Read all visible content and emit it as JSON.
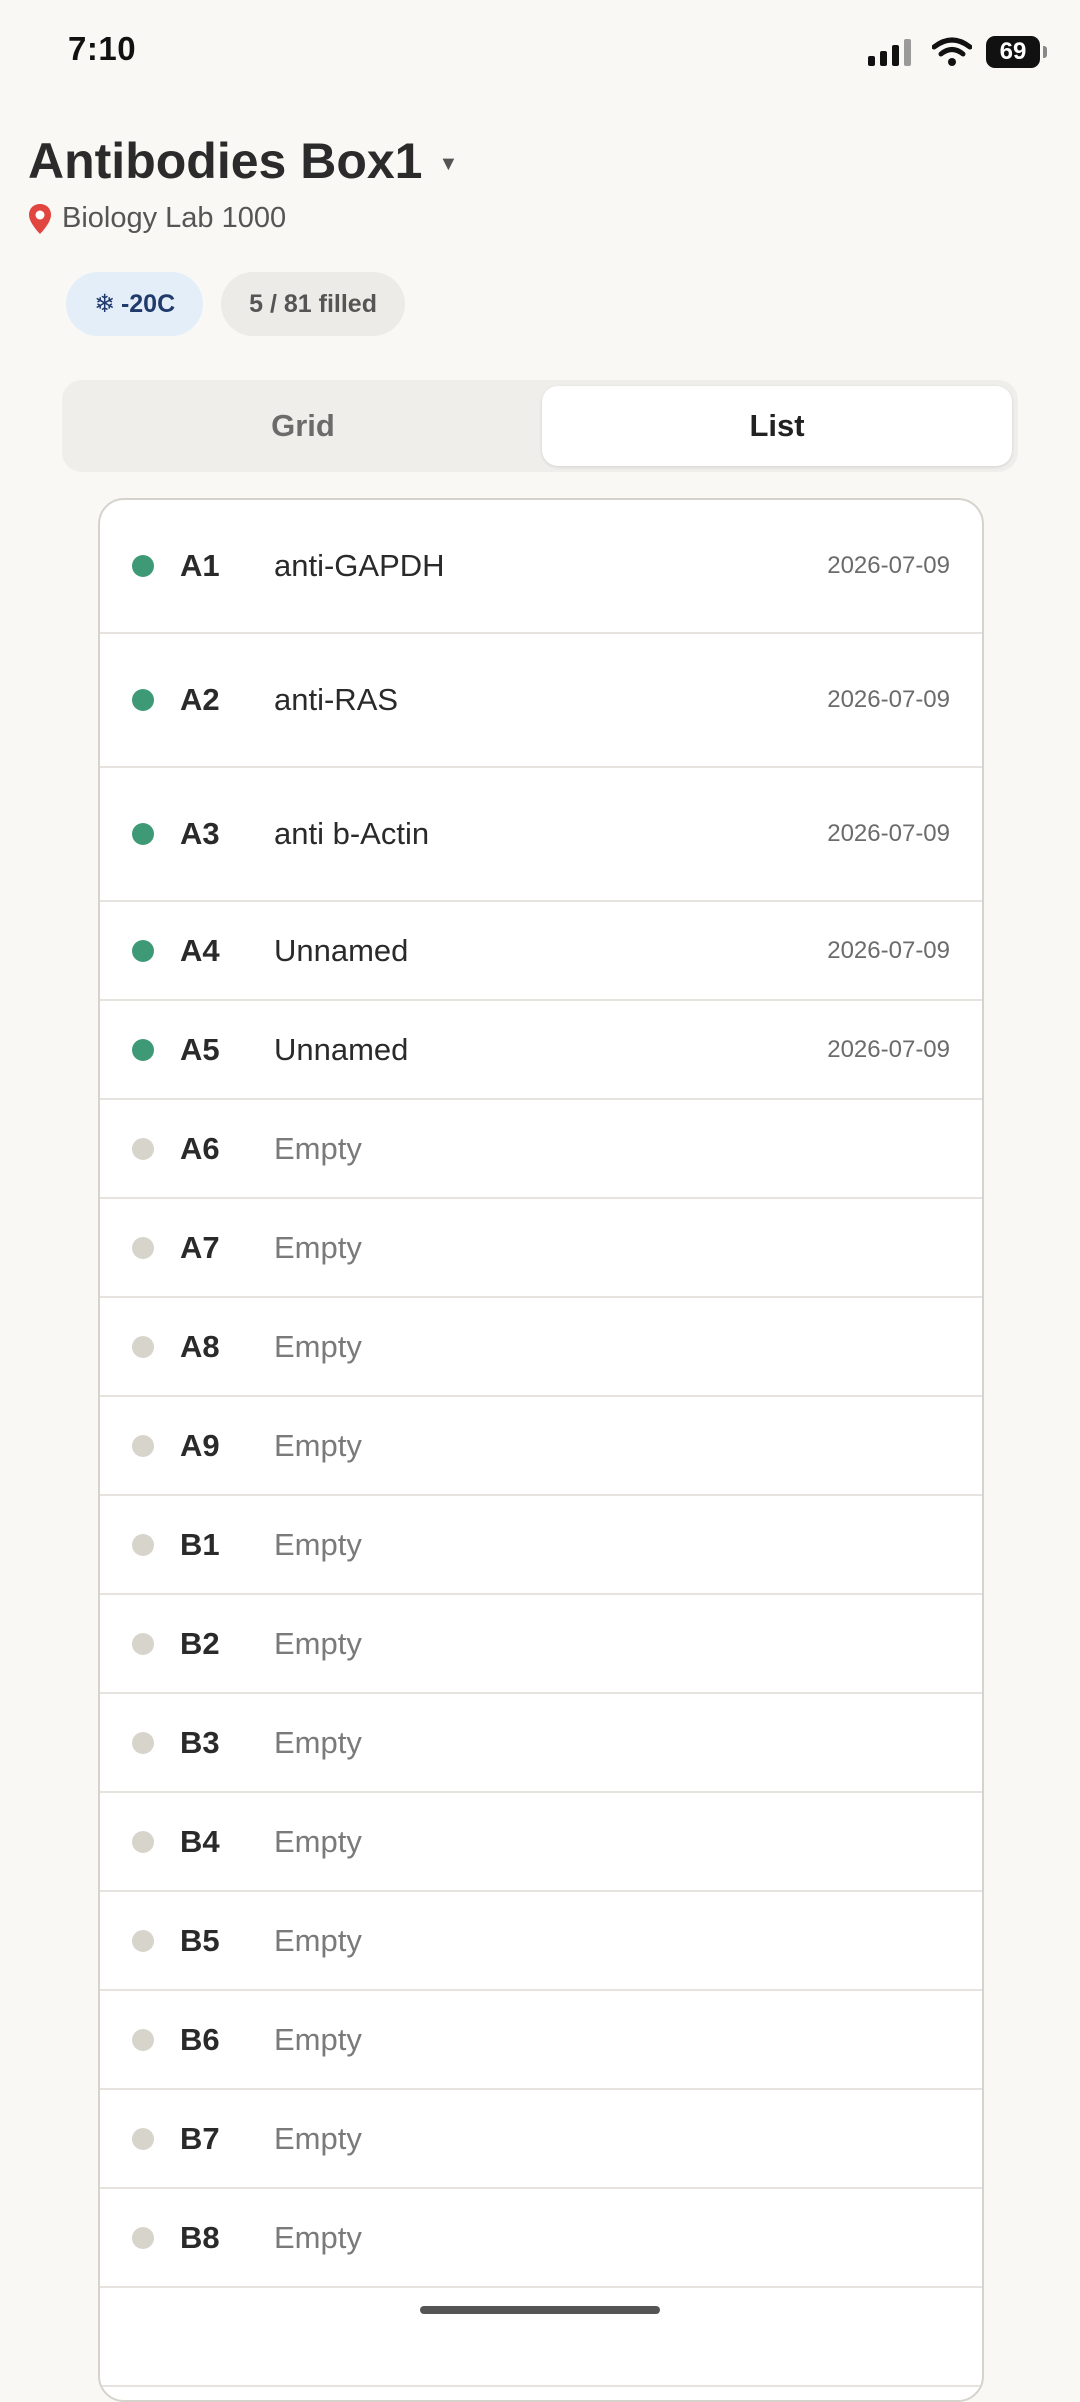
{
  "status_bar": {
    "time": "7:10",
    "battery": "69"
  },
  "header": {
    "title": "Antibodies Box1",
    "location": "Biology Lab 1000"
  },
  "chips": {
    "temperature": "-20C",
    "filled": "5 / 81 filled"
  },
  "view_toggle": {
    "grid_label": "Grid",
    "list_label": "List",
    "selected": "List"
  },
  "colors": {
    "filled_dot": "#3e9a76",
    "empty_dot": "#d7d4cc",
    "accent_blue": "#1f3a6b"
  },
  "list": {
    "rows": [
      {
        "position": "A1",
        "name": "anti-GAPDH",
        "date": "2026-07-09",
        "filled": true
      },
      {
        "position": "A2",
        "name": "anti-RAS",
        "date": "2026-07-09",
        "filled": true
      },
      {
        "position": "A3",
        "name": "anti b-Actin",
        "date": "2026-07-09",
        "filled": true
      },
      {
        "position": "A4",
        "name": "Unnamed",
        "date": "2026-07-09",
        "filled": true
      },
      {
        "position": "A5",
        "name": "Unnamed",
        "date": "2026-07-09",
        "filled": true
      },
      {
        "position": "A6",
        "name": "Empty",
        "date": "",
        "filled": false
      },
      {
        "position": "A7",
        "name": "Empty",
        "date": "",
        "filled": false
      },
      {
        "position": "A8",
        "name": "Empty",
        "date": "",
        "filled": false
      },
      {
        "position": "A9",
        "name": "Empty",
        "date": "",
        "filled": false
      },
      {
        "position": "B1",
        "name": "Empty",
        "date": "",
        "filled": false
      },
      {
        "position": "B2",
        "name": "Empty",
        "date": "",
        "filled": false
      },
      {
        "position": "B3",
        "name": "Empty",
        "date": "",
        "filled": false
      },
      {
        "position": "B4",
        "name": "Empty",
        "date": "",
        "filled": false
      },
      {
        "position": "B5",
        "name": "Empty",
        "date": "",
        "filled": false
      },
      {
        "position": "B6",
        "name": "Empty",
        "date": "",
        "filled": false
      },
      {
        "position": "B7",
        "name": "Empty",
        "date": "",
        "filled": false
      },
      {
        "position": "B8",
        "name": "Empty",
        "date": "",
        "filled": false
      }
    ]
  }
}
